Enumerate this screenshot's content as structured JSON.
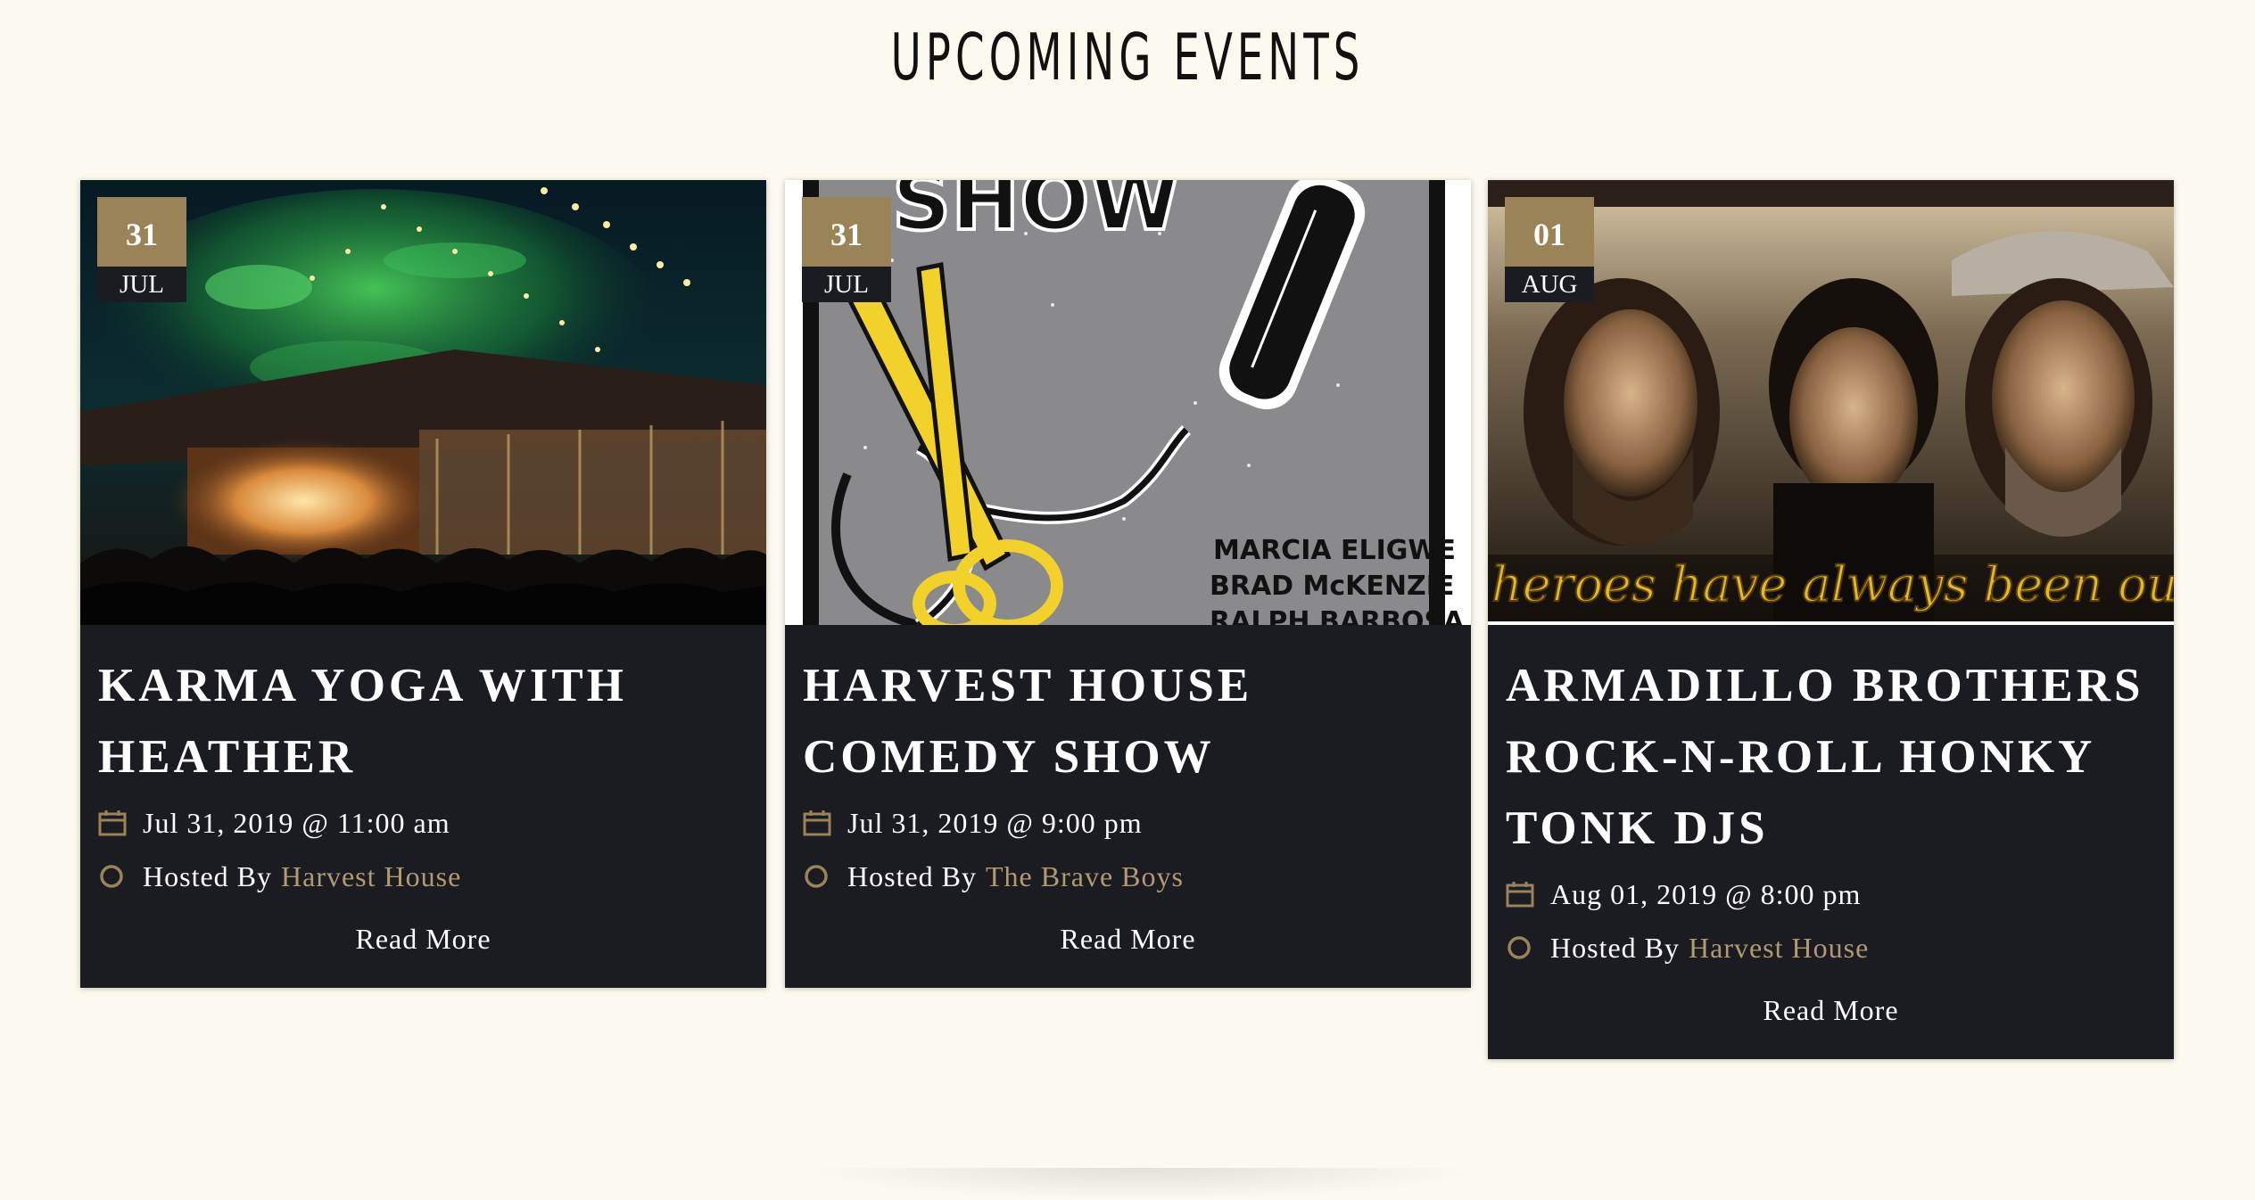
{
  "section": {
    "title": "UPCOMING EVENTS"
  },
  "events": [
    {
      "day": "31",
      "month": "JUL",
      "title": "KARMA YOGA WITH HEATHER",
      "datetime": "Jul 31, 2019 @ 11:00 am",
      "hosted_by_label": "Hosted By",
      "host": "Harvest House",
      "read_more": "Read More",
      "image": "outdoor-concert-crowd"
    },
    {
      "day": "31",
      "month": "JUL",
      "title": "HARVEST HOUSE COMEDY SHOW",
      "datetime": "Jul 31, 2019 @ 9:00 pm",
      "hosted_by_label": "Hosted By",
      "host": "The Brave Boys",
      "read_more": "Read More",
      "image": "comedy-show-poster",
      "poster_text": {
        "headline": "SHOW",
        "performers": [
          "MARCIA ELIGWE",
          "BRAD McKENZIE",
          "RALPH BARBOSA"
        ]
      }
    },
    {
      "day": "01",
      "month": "AUG",
      "title": "ARMADILLO BROTHERS ROCK-N-ROLL HONKY TONK DJS",
      "datetime": "Aug 01, 2019 @ 8:00 pm",
      "hosted_by_label": "Hosted By",
      "host": "Harvest House",
      "read_more": "Read More",
      "image": "outlaw-country-portrait",
      "image_caption": "heroes have always been outl"
    }
  ],
  "colors": {
    "page_background": "#fcfaee",
    "card_background": "#1b1b22",
    "accent_gold": "#9b8358",
    "link_gold": "#b19a72",
    "text_light": "#ffffff"
  },
  "icons": {
    "date": "calendar-icon",
    "host": "circle-icon"
  }
}
